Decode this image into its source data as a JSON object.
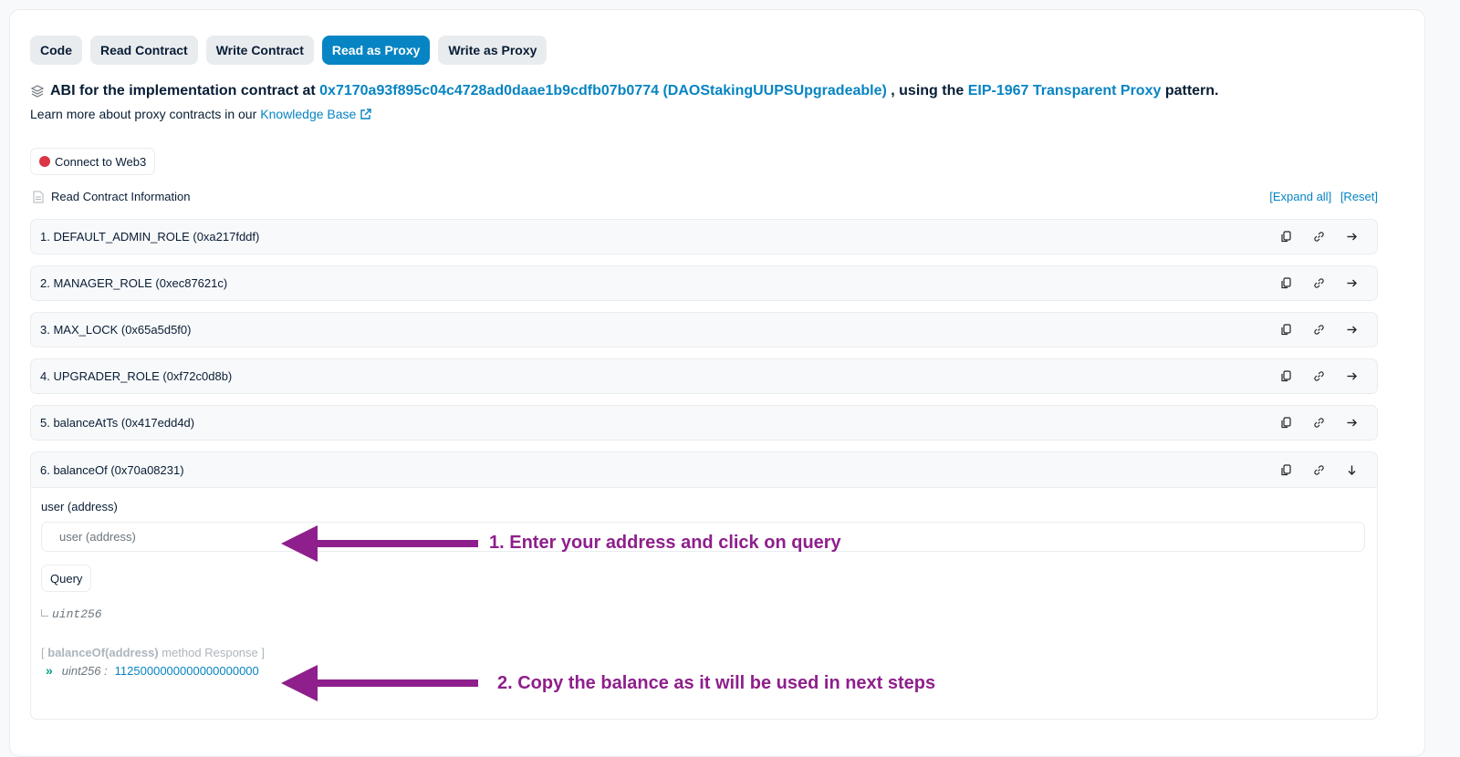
{
  "tabs": [
    {
      "label": "Code",
      "active": false
    },
    {
      "label": "Read Contract",
      "active": false
    },
    {
      "label": "Write Contract",
      "active": false
    },
    {
      "label": "Read as Proxy",
      "active": true
    },
    {
      "label": "Write as Proxy",
      "active": false
    }
  ],
  "abi": {
    "prefix": "ABI for the implementation contract at",
    "contract_link": "0x7170a93f895c04c4728ad0daae1b9cdfb07b0774 (DAOStakingUUPSUpgradeable)",
    "middle": ", using the",
    "proxy_link": "EIP-1967 Transparent Proxy",
    "suffix": "pattern."
  },
  "learn": {
    "text": "Learn more about proxy contracts in our",
    "link": "Knowledge Base"
  },
  "connect_label": "Connect to Web3",
  "info": {
    "title": "Read Contract Information",
    "expand_all": "[Expand all]",
    "reset": "[Reset]"
  },
  "functions": [
    {
      "label": "1. DEFAULT_ADMIN_ROLE (0xa217fddf)"
    },
    {
      "label": "2. MANAGER_ROLE (0xec87621c)"
    },
    {
      "label": "3. MAX_LOCK (0x65a5d5f0)"
    },
    {
      "label": "4. UPGRADER_ROLE (0xf72c0d8b)"
    },
    {
      "label": "5. balanceAtTs (0x417edd4d)"
    },
    {
      "label": "6. balanceOf (0x70a08231)"
    }
  ],
  "expanded": {
    "param_label": "user (address)",
    "param_placeholder": "user (address)",
    "query_label": "Query",
    "return_type": "uint256",
    "response_open": "[",
    "response_method": "balanceOf(address)",
    "response_rest": "method Response ]",
    "response_type": "uint256 :",
    "response_value": "1125000000000000000000"
  },
  "annotations": {
    "step1": "1. Enter your address and click on query",
    "step2": "2. Copy the balance as it will be used in next steps"
  },
  "colors": {
    "accent": "#0784c3",
    "annotation": "#8e1f8c",
    "disconnected": "#dc3545"
  }
}
